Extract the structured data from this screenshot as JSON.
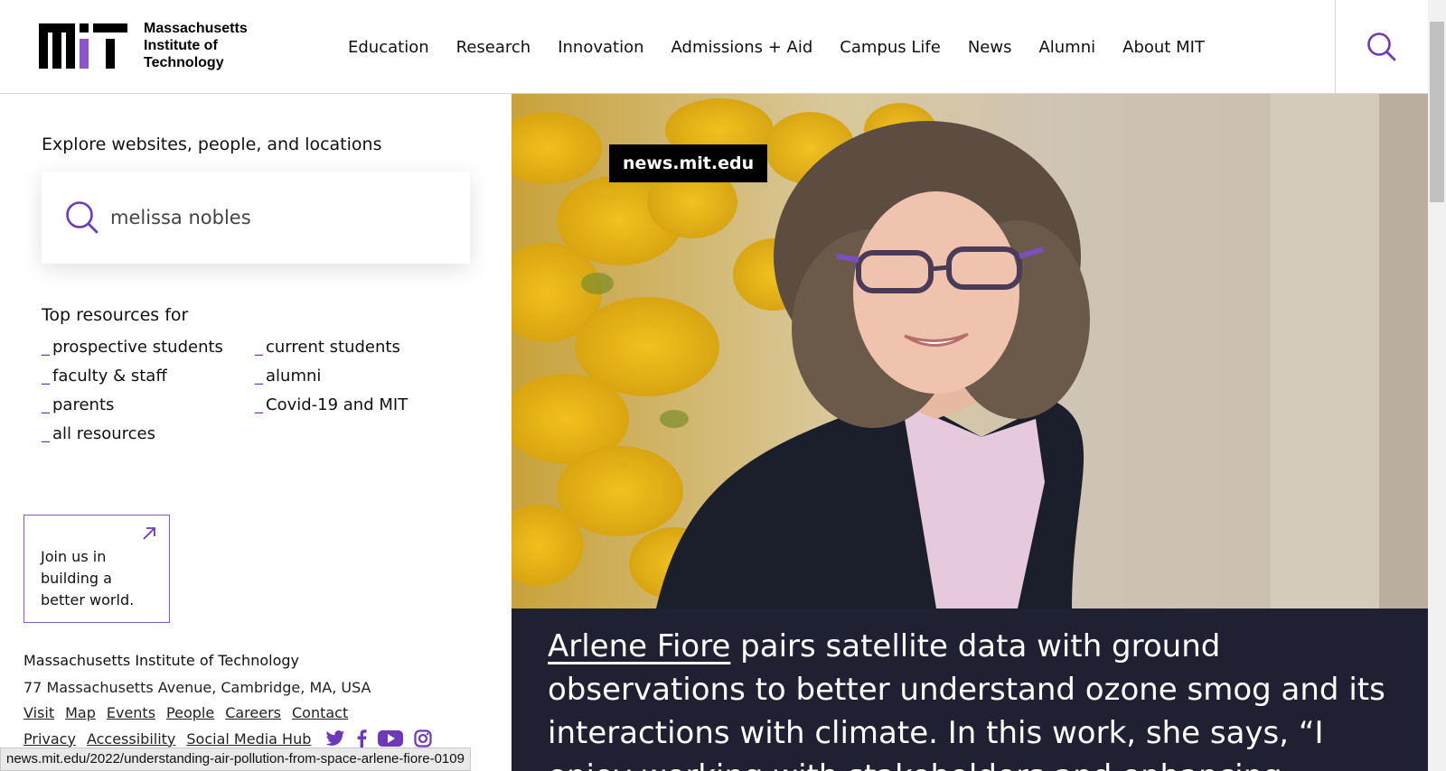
{
  "header": {
    "logo_line1": "Massachusetts",
    "logo_line2": "Institute of",
    "logo_line3": "Technology",
    "nav": [
      "Education",
      "Research",
      "Innovation",
      "Admissions + Aid",
      "Campus Life",
      "News",
      "Alumni",
      "About MIT"
    ]
  },
  "left": {
    "explore_title": "Explore websites, people, and locations",
    "search_value": "melissa nobles",
    "top_title": "Top resources for",
    "resources": [
      "prospective students",
      "current students",
      "faculty & staff",
      "alumni",
      "parents",
      "Covid-19 and MIT",
      "all resources"
    ],
    "dash": "_",
    "join_line1": "Join us in",
    "join_line2": "building a",
    "join_line3": "better world.",
    "footer_name": "Massachusetts Institute of Technology",
    "footer_addr": "77 Massachusetts Avenue, Cambridge, MA, USA",
    "footer_links": [
      "Visit",
      "Map",
      "Events",
      "People",
      "Careers",
      "Contact"
    ],
    "footer_links2": [
      "Privacy",
      "Accessibility",
      "Social Media Hub"
    ]
  },
  "hero": {
    "badge": "news.mit.edu",
    "caption_name": "Arlene Fiore",
    "caption_rest": " pairs satellite data with ground observations to better understand ozone smog and its interactions with climate. In this work, she says, “I enjoy working with stakeholders and enhancing"
  },
  "status": "news.mit.edu/2022/understanding-air-pollution-from-space-arlene-fiore-0109",
  "colors": {
    "accent": "#750014",
    "purple": "#6c3ab8",
    "caption_bg": "#1f2133"
  }
}
